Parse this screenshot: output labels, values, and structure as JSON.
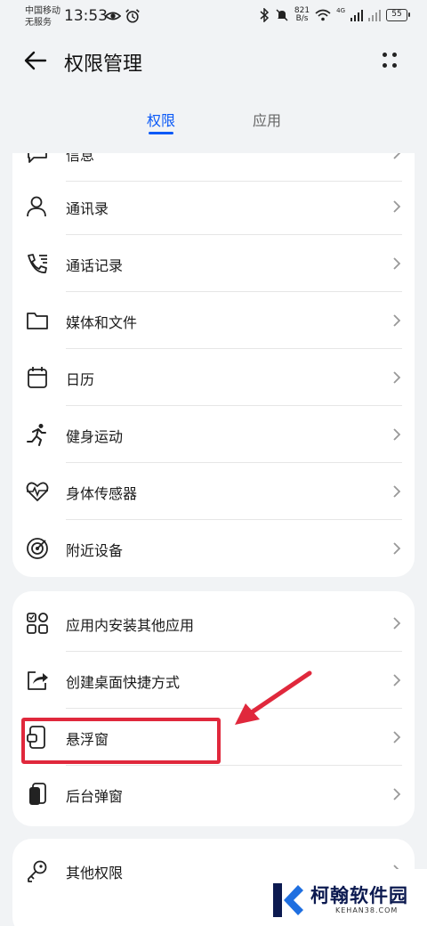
{
  "status_bar": {
    "carrier_line1": "中国移动",
    "carrier_line2": "无服务",
    "time": "13:53",
    "net_speed_value": "821",
    "net_speed_unit": "B/s",
    "network_type": "4G",
    "battery": "55"
  },
  "header": {
    "title": "权限管理"
  },
  "tabs": [
    {
      "label": "权限",
      "active": true
    },
    {
      "label": "应用",
      "active": false
    }
  ],
  "group1": {
    "partial_item_label": "信息",
    "items": [
      {
        "label": "通讯录",
        "icon": "contacts-icon"
      },
      {
        "label": "通话记录",
        "icon": "call-log-icon"
      },
      {
        "label": "媒体和文件",
        "icon": "folder-icon"
      },
      {
        "label": "日历",
        "icon": "calendar-icon"
      },
      {
        "label": "健身运动",
        "icon": "running-icon"
      },
      {
        "label": "身体传感器",
        "icon": "heart-rate-icon"
      },
      {
        "label": "附近设备",
        "icon": "nearby-devices-icon"
      }
    ]
  },
  "group2": {
    "items": [
      {
        "label": "应用内安装其他应用",
        "icon": "app-grid-icon"
      },
      {
        "label": "创建桌面快捷方式",
        "icon": "shortcut-icon"
      },
      {
        "label": "悬浮窗",
        "icon": "floating-window-icon"
      },
      {
        "label": "后台弹窗",
        "icon": "background-popup-icon"
      }
    ]
  },
  "group3": {
    "items": [
      {
        "label": "其他权限",
        "icon": "key-icon"
      }
    ]
  },
  "watermark": {
    "name": "柯翰软件园",
    "url": "KEHAN38.COM"
  },
  "colors": {
    "accent": "#0a59f7",
    "highlight": "#e0283c",
    "background": "#f1f3f5"
  }
}
